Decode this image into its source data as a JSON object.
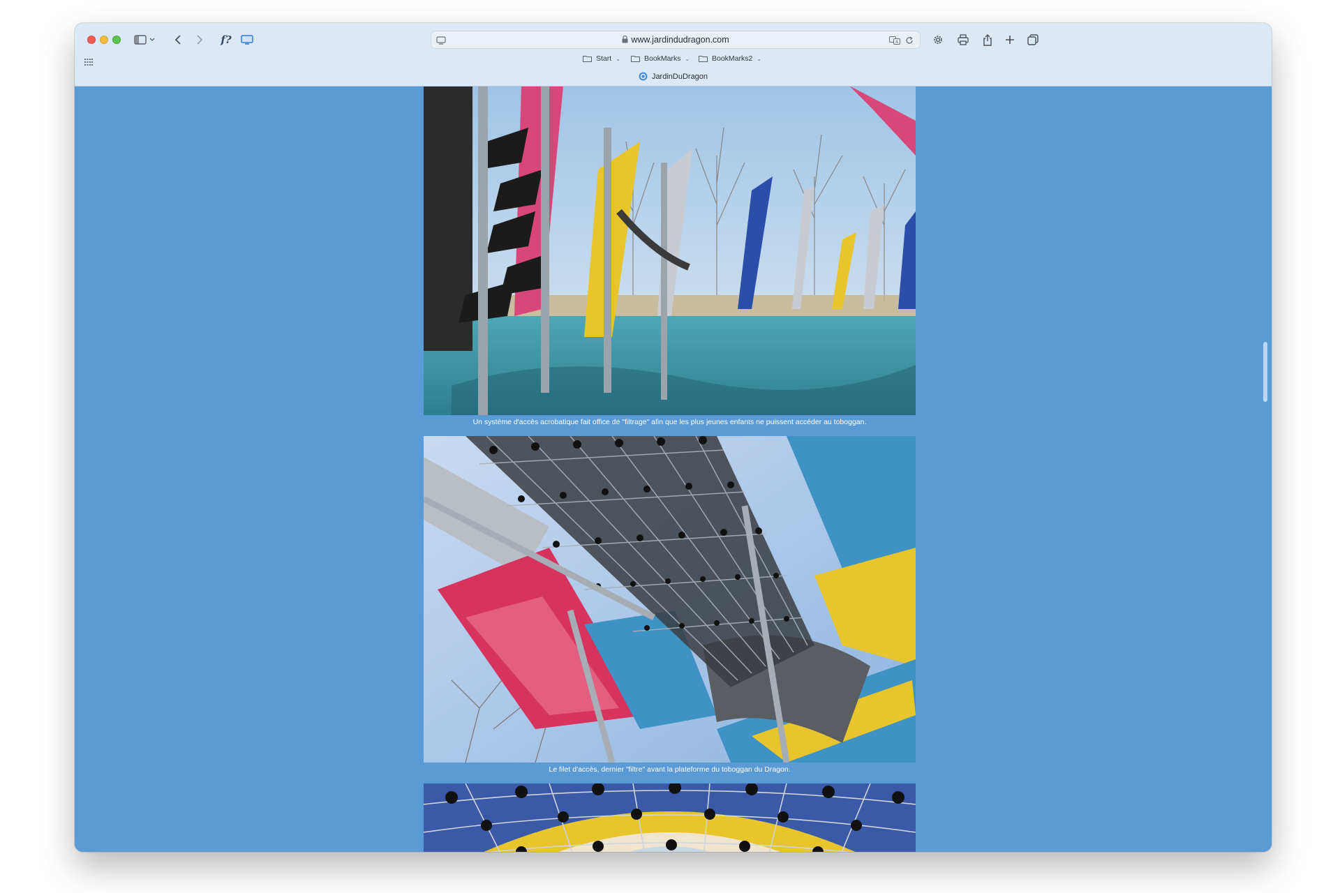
{
  "window": {
    "url": "www.jardindudragon.com",
    "tab_title": "JardinDuDragon",
    "fx_label": "f?"
  },
  "bookmarks": [
    {
      "label": "Start"
    },
    {
      "label": "BookMarks"
    },
    {
      "label": "BookMarks2"
    }
  ],
  "icons": [
    "sidebar-icon",
    "back-icon",
    "forward-icon",
    "formula-icon",
    "screen-icon",
    "settings-icon",
    "print-icon",
    "share-icon",
    "new-tab-icon",
    "tabs-overview-icon",
    "translate-icon",
    "reload-icon",
    "lock-icon",
    "grid-icon",
    "folder-icon"
  ],
  "content": {
    "background_color": "#5b9bd5",
    "items": [
      {
        "caption": "Un système d'accès acrobatique fait office de \"filtrage\" afin que les plus jeunes enfants ne puissent accéder au toboggan."
      },
      {
        "caption": "Le filet d'accès, dernier \"filtre\" avant la plateforme du toboggan du Dragon."
      }
    ]
  }
}
